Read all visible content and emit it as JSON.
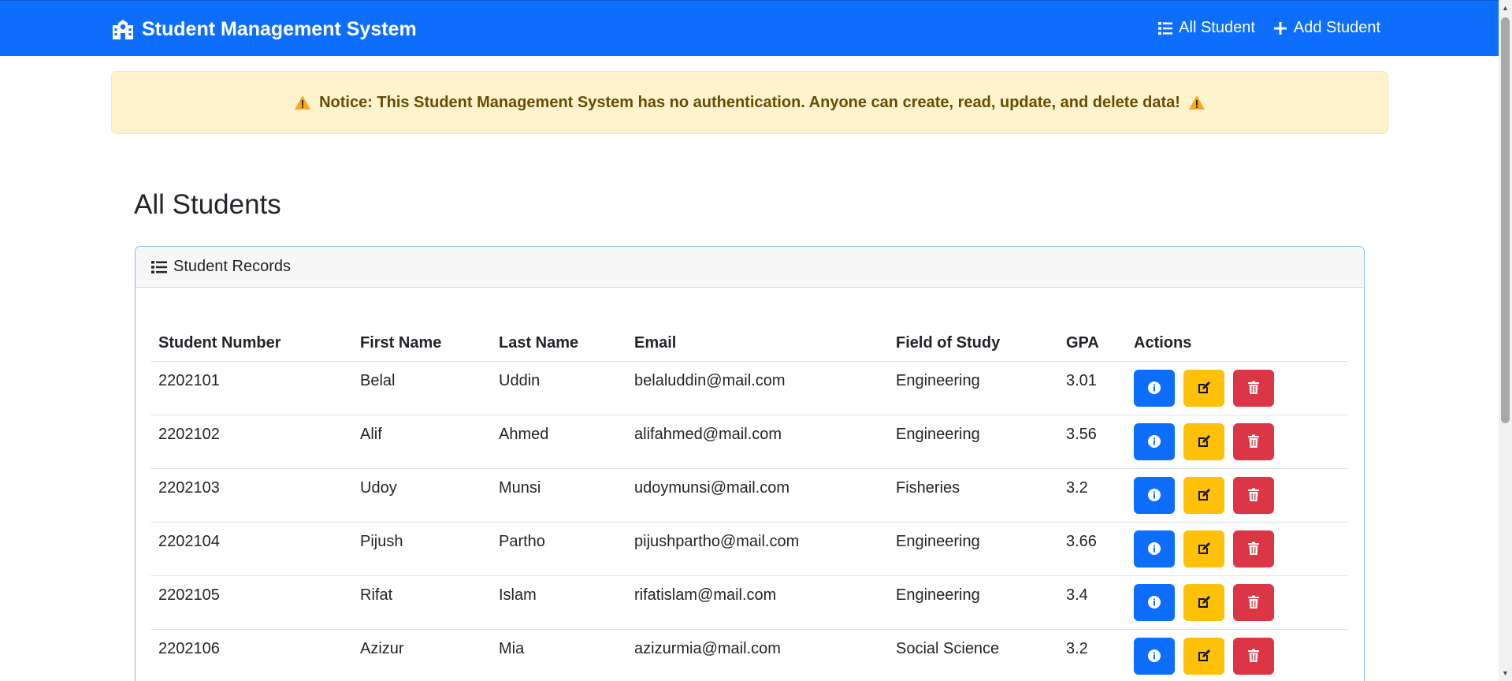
{
  "navbar": {
    "brand": "Student Management System",
    "links": [
      {
        "label": "All Student",
        "icon": "list-icon"
      },
      {
        "label": "Add Student",
        "icon": "plus-icon"
      }
    ]
  },
  "alert": {
    "text": "Notice: This Student Management System has no authentication. Anyone can create, read, update, and delete data!"
  },
  "page": {
    "title": "All Students"
  },
  "card": {
    "header": "Student Records"
  },
  "table": {
    "headers": [
      "Student Number",
      "First Name",
      "Last Name",
      "Email",
      "Field of Study",
      "GPA",
      "Actions"
    ],
    "rows": [
      {
        "number": "2202101",
        "first": "Belal",
        "last": "Uddin",
        "email": "belaluddin@mail.com",
        "field": "Engineering",
        "gpa": "3.01"
      },
      {
        "number": "2202102",
        "first": "Alif",
        "last": "Ahmed",
        "email": "alifahmed@mail.com",
        "field": "Engineering",
        "gpa": "3.56"
      },
      {
        "number": "2202103",
        "first": "Udoy",
        "last": "Munsi",
        "email": "udoymunsi@mail.com",
        "field": "Fisheries",
        "gpa": "3.2"
      },
      {
        "number": "2202104",
        "first": "Pijush",
        "last": "Partho",
        "email": "pijushpartho@mail.com",
        "field": "Engineering",
        "gpa": "3.66"
      },
      {
        "number": "2202105",
        "first": "Rifat",
        "last": "Islam",
        "email": "rifatislam@mail.com",
        "field": "Engineering",
        "gpa": "3.4"
      },
      {
        "number": "2202106",
        "first": "Azizur",
        "last": "Mia",
        "email": "azizurmia@mail.com",
        "field": "Social Science",
        "gpa": "3.2"
      }
    ]
  },
  "colors": {
    "primary": "#0d6efd",
    "warning": "#ffc107",
    "danger": "#dc3545",
    "alert_bg": "#fff3cd",
    "alert_text": "#664d03"
  }
}
